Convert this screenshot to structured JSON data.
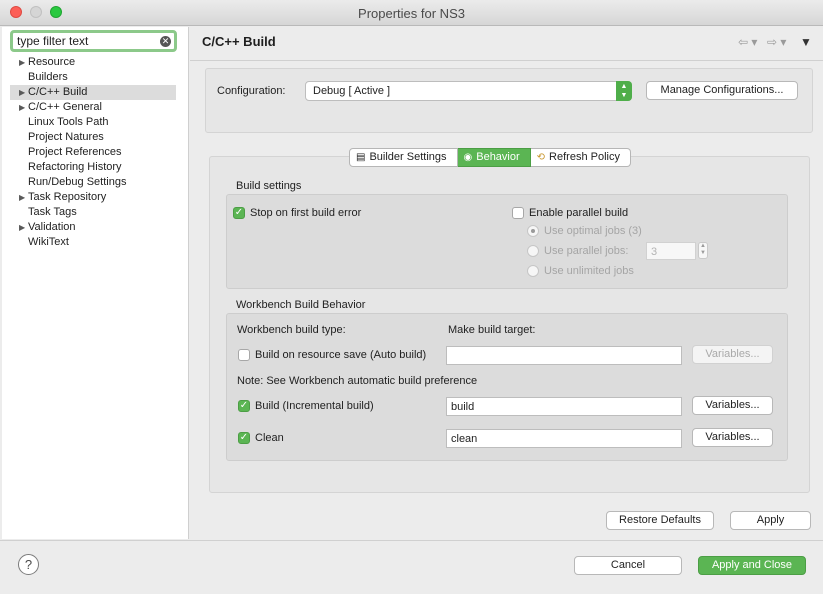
{
  "window": {
    "title": "Properties for NS3",
    "controls": {
      "close_color": "#fc5f57",
      "minimize_color": "#d5d5d5",
      "zoom_color": "#2ac940"
    }
  },
  "sidebar": {
    "filter": {
      "value": "type filter text",
      "clear_icon": "clear-circle-icon"
    },
    "items": [
      {
        "label": "Resource",
        "expandable": true
      },
      {
        "label": "Builders",
        "expandable": false
      },
      {
        "label": "C/C++ Build",
        "expandable": true,
        "selected": true
      },
      {
        "label": "C/C++ General",
        "expandable": true
      },
      {
        "label": "Linux Tools Path",
        "expandable": false
      },
      {
        "label": "Project Natures",
        "expandable": false
      },
      {
        "label": "Project References",
        "expandable": false
      },
      {
        "label": "Refactoring History",
        "expandable": false
      },
      {
        "label": "Run/Debug Settings",
        "expandable": false
      },
      {
        "label": "Task Repository",
        "expandable": true
      },
      {
        "label": "Task Tags",
        "expandable": false
      },
      {
        "label": "Validation",
        "expandable": true
      },
      {
        "label": "WikiText",
        "expandable": false
      }
    ]
  },
  "header": {
    "title": "C/C++ Build",
    "back_icon": "back-arrow-icon",
    "forward_icon": "forward-arrow-icon",
    "menu_icon": "dropdown-menu-icon"
  },
  "configuration": {
    "label": "Configuration:",
    "selected": "Debug  [ Active ]",
    "manage_button": "Manage Configurations..."
  },
  "tabs": [
    {
      "label": "Builder Settings",
      "icon": "builder-settings-icon",
      "active": false
    },
    {
      "label": "Behavior",
      "icon": "behavior-icon",
      "active": true
    },
    {
      "label": "Refresh Policy",
      "icon": "refresh-policy-icon",
      "active": false
    }
  ],
  "build_settings": {
    "title": "Build settings",
    "stop_on_error": {
      "label": "Stop on first build error",
      "checked": true
    },
    "parallel_build": {
      "label": "Enable parallel build",
      "checked": false
    },
    "optimal_jobs": {
      "label": "Use optimal jobs (3)",
      "selected": true,
      "enabled": false
    },
    "parallel_jobs": {
      "label": "Use parallel jobs:",
      "value": "3",
      "enabled": false
    },
    "unlimited_jobs": {
      "label": "Use unlimited jobs",
      "enabled": false
    }
  },
  "workbench": {
    "title": "Workbench Build Behavior",
    "type_header": "Workbench build type:",
    "target_header": "Make build target:",
    "note": "Note: See Workbench automatic build preference",
    "rows": [
      {
        "label": "Build on resource save (Auto build)",
        "checked": false,
        "target": "",
        "variables": "Variables...",
        "enabled": false
      },
      {
        "label": "Build (Incremental build)",
        "checked": true,
        "target": "build",
        "variables": "Variables...",
        "enabled": true
      },
      {
        "label": "Clean",
        "checked": true,
        "target": "clean",
        "variables": "Variables...",
        "enabled": true
      }
    ]
  },
  "page_buttons": {
    "restore_defaults": "Restore Defaults",
    "apply": "Apply"
  },
  "footer": {
    "help_icon": "help-icon",
    "help_glyph": "?",
    "cancel": "Cancel",
    "apply_and_close": "Apply and Close"
  }
}
